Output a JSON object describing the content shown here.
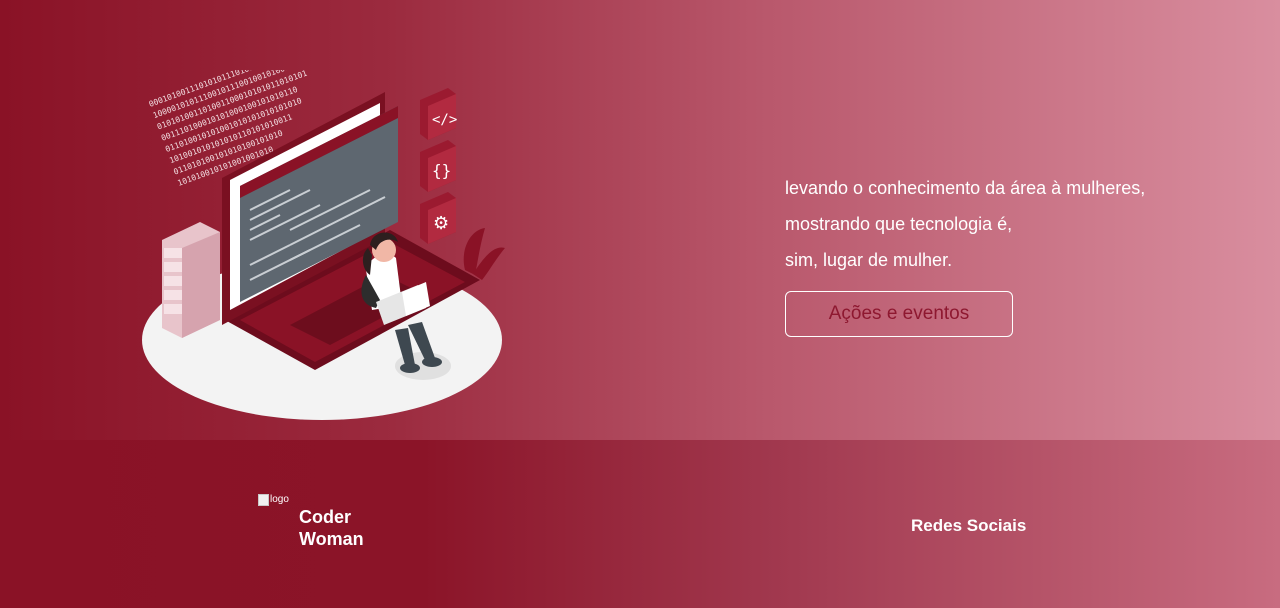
{
  "hero": {
    "line1": "levando o conhecimento da área à mulheres,",
    "line2": "mostrando que tecnologia é,",
    "line3": "sim, lugar de mulher.",
    "button_label": "Ações e eventos",
    "binary_rows": [
      "000101001110101011101010001010101",
      "100001010111001011100100101001",
      "010101001101001100010101011010101",
      "001110100010101000100101010110",
      "011010010101001010101010101010",
      "101001010101010110101010011",
      "011010100101010100101010",
      "101010010101001001010"
    ]
  },
  "footer": {
    "logo_alt": "logo",
    "brand_line1": "Coder",
    "brand_line2": "Woman",
    "social_title": "Redes Sociais"
  },
  "colors": {
    "brand_dark": "#8a1226",
    "brand_mid": "#a62b40",
    "brand_light": "#d98e9f",
    "button_text": "#8e1830"
  }
}
